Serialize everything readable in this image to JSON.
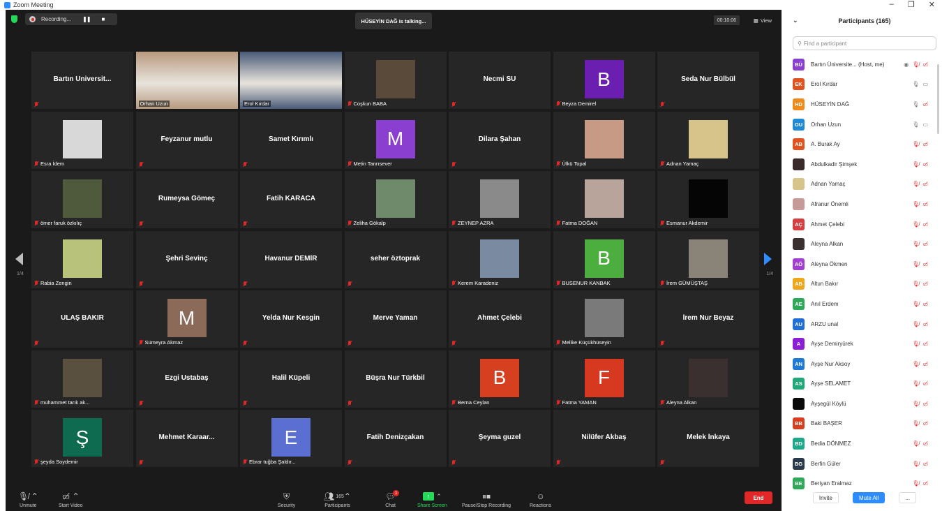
{
  "window": {
    "title": "Zoom Meeting"
  },
  "topbar": {
    "recording_label": "Recording...",
    "talking": "HÜSEYİN DAĞ is talking...",
    "timer": "00:10:06",
    "view_label": "View"
  },
  "pagination": {
    "left": "1/4",
    "right": "1/4"
  },
  "tiles": [
    {
      "name": "Bartın Üniversit...",
      "kind": "text",
      "muted": true
    },
    {
      "name": "Orhan Uzun",
      "kind": "video",
      "muted": false,
      "bg": "#b89a7f"
    },
    {
      "name": "Erol Kırdar",
      "kind": "video",
      "muted": false,
      "bg": "#4a5a78"
    },
    {
      "name": "Coşkun BABA",
      "kind": "photo",
      "muted": true,
      "color": "#5a4a3a"
    },
    {
      "name": "Necmi SU",
      "kind": "text",
      "muted": true
    },
    {
      "name": "Beyza Demirel",
      "kind": "avatar",
      "letter": "B",
      "color": "#6b1fb1",
      "muted": true
    },
    {
      "name": "Seda Nur Bülbül",
      "kind": "text",
      "muted": true
    },
    {
      "name": "Esra İdem",
      "kind": "photo",
      "muted": true,
      "color": "#d8d8d8"
    },
    {
      "name": "Feyzanur mutlu",
      "kind": "text",
      "muted": true
    },
    {
      "name": "Samet Kırımlı",
      "kind": "text",
      "muted": true
    },
    {
      "name": "Metin Tanrısever",
      "kind": "avatar",
      "letter": "M",
      "color": "#8a3fd1",
      "muted": true
    },
    {
      "name": "Dilara Şahan",
      "kind": "text",
      "muted": true
    },
    {
      "name": "Ülkü Topal",
      "kind": "photo",
      "muted": true,
      "color": "#c79a86"
    },
    {
      "name": "Adnan Yamaç",
      "kind": "photo",
      "muted": true,
      "color": "#d6c48a"
    },
    {
      "name": "ömer faruk özkılıç",
      "kind": "photo",
      "muted": true,
      "color": "#4f5a3c"
    },
    {
      "name": "Rumeysa Gömeç",
      "kind": "text",
      "muted": true
    },
    {
      "name": "Fatih KARACA",
      "kind": "text",
      "muted": true
    },
    {
      "name": "Zeliha Gökalp",
      "kind": "photo",
      "muted": true,
      "color": "#6e8a6a"
    },
    {
      "name": "ZEYNEP AZRA",
      "kind": "photo",
      "muted": true,
      "color": "#8a8a8a"
    },
    {
      "name": "Fatma DOĞAN",
      "kind": "photo",
      "muted": true,
      "color": "#b8a49a"
    },
    {
      "name": "Esmanur Akdemir",
      "kind": "photo",
      "muted": true,
      "color": "#050505"
    },
    {
      "name": "Rabia Zengin",
      "kind": "photo",
      "muted": true,
      "color": "#b9c27a"
    },
    {
      "name": "Şehri Sevinç",
      "kind": "text",
      "muted": true
    },
    {
      "name": "Havanur DEMİR",
      "kind": "text",
      "muted": true
    },
    {
      "name": "seher öztoprak",
      "kind": "text",
      "muted": true
    },
    {
      "name": "Kerem Karadeniz",
      "kind": "photo",
      "muted": true,
      "color": "#7a8aa0"
    },
    {
      "name": "BUSENUR KANBAK",
      "kind": "avatar",
      "letter": "B",
      "color": "#4cae3f",
      "muted": true
    },
    {
      "name": "İrem GÜMÜŞTAŞ",
      "kind": "photo",
      "muted": true,
      "color": "#8a8478"
    },
    {
      "name": "ULAŞ BAKIR",
      "kind": "text",
      "muted": true
    },
    {
      "name": "Sümeyra Akmaz",
      "kind": "avatar",
      "letter": "M",
      "color": "#8c6a5a",
      "muted": true
    },
    {
      "name": "Yelda Nur Kesgin",
      "kind": "text",
      "muted": true
    },
    {
      "name": "Merve Yaman",
      "kind": "text",
      "muted": true
    },
    {
      "name": "Ahmet Çelebi",
      "kind": "text",
      "muted": true
    },
    {
      "name": "Melike Küçükhüseyin",
      "kind": "photo",
      "muted": true,
      "color": "#7a7a7a"
    },
    {
      "name": "İrem Nur Beyaz",
      "kind": "text",
      "muted": true
    },
    {
      "name": "muhammet tarık ak...",
      "kind": "photo",
      "muted": true,
      "color": "#5a5040"
    },
    {
      "name": "Ezgi Ustabaş",
      "kind": "text",
      "muted": true
    },
    {
      "name": "Halil Küpeli",
      "kind": "text",
      "muted": true
    },
    {
      "name": "Büşra Nur Türkbil",
      "kind": "text",
      "muted": true
    },
    {
      "name": "Berna Ceylan",
      "kind": "avatar",
      "letter": "B",
      "color": "#d63f1f",
      "muted": true
    },
    {
      "name": "Fatma YAMAN",
      "kind": "avatar",
      "letter": "F",
      "color": "#d6391f",
      "muted": true
    },
    {
      "name": "Aleyna Alkan",
      "kind": "photo",
      "muted": true,
      "color": "#3a3030"
    },
    {
      "name": "şeyda Soydemir",
      "kind": "avatar",
      "letter": "Ş",
      "color": "#0f6b4f",
      "muted": true
    },
    {
      "name": "Mehmet Karaar...",
      "kind": "text",
      "muted": true
    },
    {
      "name": "Ebrar tuğba Şaldır...",
      "kind": "avatar",
      "letter": "E",
      "color": "#5a6fd1",
      "muted": true
    },
    {
      "name": "Fatih Denizçakan",
      "kind": "text",
      "muted": true
    },
    {
      "name": "Şeyma guzel",
      "kind": "text",
      "muted": true
    },
    {
      "name": "Nilüfer Akbaş",
      "kind": "text",
      "muted": true
    },
    {
      "name": "Melek İnkaya",
      "kind": "text",
      "muted": true
    }
  ],
  "toolbar": {
    "unmute": "Unmute",
    "start_video": "Start Video",
    "security": "Security",
    "participants": "Participants",
    "participants_count": "165",
    "chat": "Chat",
    "chat_badge": "1",
    "share_screen": "Share Screen",
    "pause_recording": "Pause/Stop Recording",
    "reactions": "Reactions",
    "end": "End"
  },
  "panel": {
    "title": "Participants (165)",
    "search_placeholder": "Find a participant",
    "participants": [
      {
        "initials": "BÜ",
        "name": "Bartın Üniversite...  (Host, me)",
        "color": "#8a3fd1",
        "state": "host"
      },
      {
        "initials": "EK",
        "name": "Erol Kırdar",
        "color": "#e0531f",
        "state": "on"
      },
      {
        "initials": "HD",
        "name": "HÜSEYİN DAĞ",
        "color": "#f08a1a",
        "state": "speaking"
      },
      {
        "initials": "OU",
        "name": "Orhan Uzun",
        "color": "#1f8ad6",
        "state": "on"
      },
      {
        "initials": "AB",
        "name": "A. Burak Ay",
        "color": "#e0531f",
        "state": "muted"
      },
      {
        "initials": "",
        "name": "Abdulkadir Şimşek",
        "color": "#3a2a2a",
        "state": "muted"
      },
      {
        "initials": "",
        "name": "Adnan Yamaç",
        "color": "#d6c48a",
        "state": "muted"
      },
      {
        "initials": "",
        "name": "Afranur Önemli",
        "color": "#c79a9a",
        "state": "muted"
      },
      {
        "initials": "AÇ",
        "name": "Ahmet Çelebi",
        "color": "#d63f3f",
        "state": "muted"
      },
      {
        "initials": "",
        "name": "Aleyna Alkan",
        "color": "#3a3030",
        "state": "muted"
      },
      {
        "initials": "AÖ",
        "name": "Aleyna Ökmen",
        "color": "#a03fd1",
        "state": "muted"
      },
      {
        "initials": "AB",
        "name": "Altun Bakır",
        "color": "#f0a61a",
        "state": "muted"
      },
      {
        "initials": "AE",
        "name": "Anıl Erdem",
        "color": "#2fa85a",
        "state": "muted"
      },
      {
        "initials": "AU",
        "name": "ARZU unal",
        "color": "#1f6fd6",
        "state": "muted"
      },
      {
        "initials": "A",
        "name": "Ayşe Demiryürek",
        "color": "#8a1fd6",
        "state": "muted"
      },
      {
        "initials": "AN",
        "name": "Ayşe Nur Aksoy",
        "color": "#1f7ad6",
        "state": "muted"
      },
      {
        "initials": "AS",
        "name": "Ayşe SELAMET",
        "color": "#1fa87a",
        "state": "muted"
      },
      {
        "initials": "",
        "name": "Ayşegül Köylü",
        "color": "#0a0a0a",
        "state": "muted"
      },
      {
        "initials": "BB",
        "name": "Baki BAŞER",
        "color": "#d63f1f",
        "state": "muted"
      },
      {
        "initials": "BD",
        "name": "Bedia DÖNMEZ",
        "color": "#1fa88a",
        "state": "muted"
      },
      {
        "initials": "BG",
        "name": "Berfin Güler",
        "color": "#2a3a4a",
        "state": "muted"
      },
      {
        "initials": "BE",
        "name": "Beriyan Eralmaz",
        "color": "#2fa85a",
        "state": "muted"
      }
    ],
    "invite": "Invite",
    "mute_all": "Mute All",
    "more": "..."
  }
}
